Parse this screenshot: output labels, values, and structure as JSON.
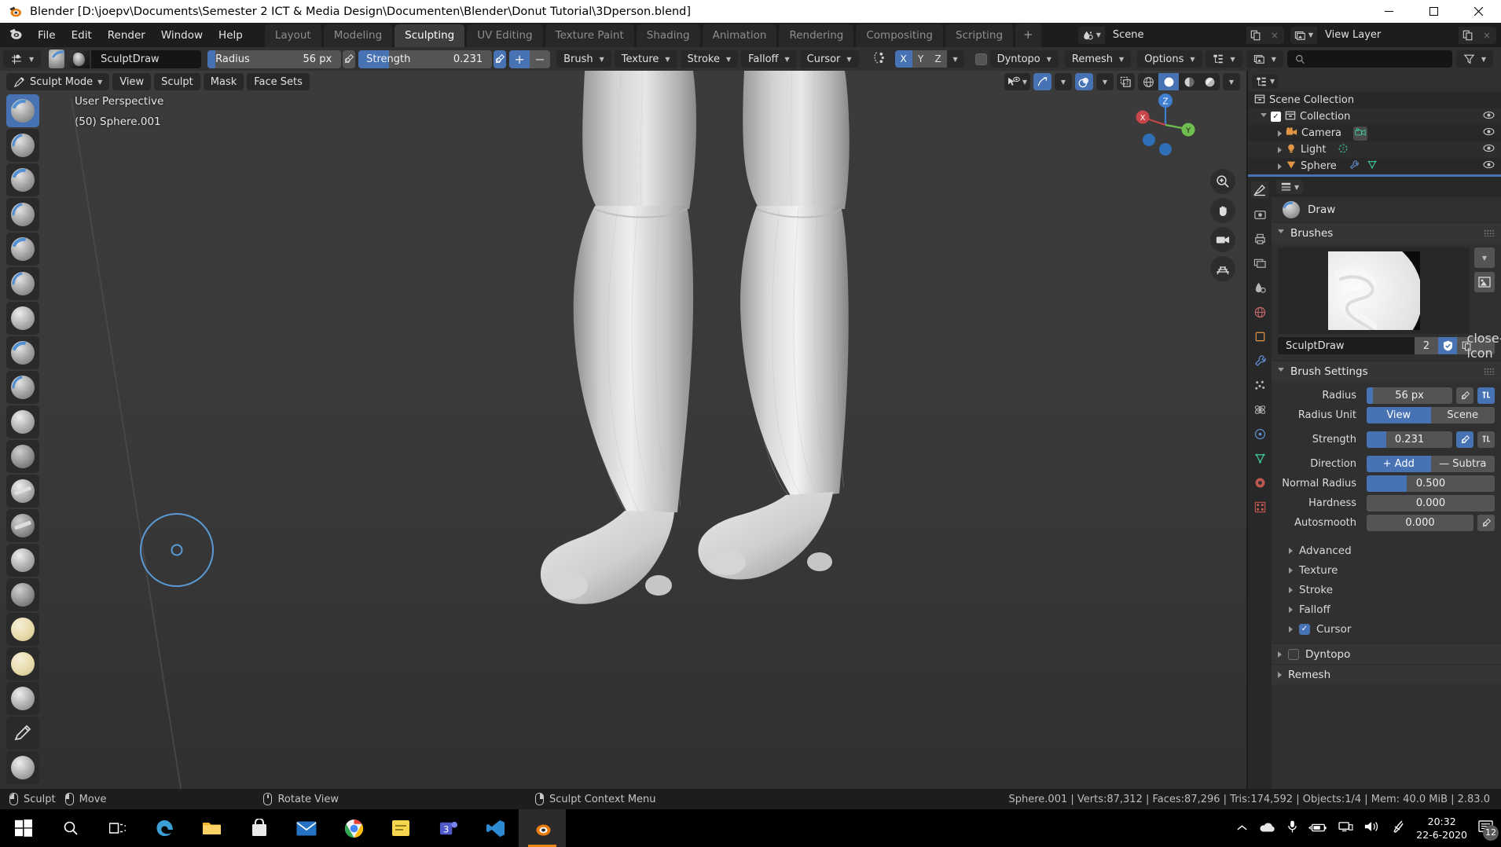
{
  "window": {
    "title": "Blender [D:\\joepv\\Documents\\Semester 2 ICT & Media Design\\Documenten\\Blender\\Donut Tutorial\\3Dperson.blend]",
    "minimize": "minimize-icon",
    "maximize": "maximize-icon",
    "close": "close-icon"
  },
  "topbar": {
    "logo": "blender-logo-icon",
    "menus": [
      "File",
      "Edit",
      "Render",
      "Window",
      "Help"
    ],
    "workspaces": [
      {
        "label": "Layout",
        "active": false
      },
      {
        "label": "Modeling",
        "active": false
      },
      {
        "label": "Sculpting",
        "active": true
      },
      {
        "label": "UV Editing",
        "active": false
      },
      {
        "label": "Texture Paint",
        "active": false
      },
      {
        "label": "Shading",
        "active": false
      },
      {
        "label": "Animation",
        "active": false
      },
      {
        "label": "Rendering",
        "active": false
      },
      {
        "label": "Compositing",
        "active": false
      },
      {
        "label": "Scripting",
        "active": false
      }
    ],
    "add_workspace": "+",
    "scene": {
      "name": "Scene",
      "new_label": "new-scene-icon",
      "unlink_label": "×"
    },
    "view_layer": {
      "name": "View Layer",
      "new_label": "new-viewlayer-icon",
      "unlink_label": "×"
    }
  },
  "tool_header": {
    "brush_name": "SculptDraw",
    "radius": {
      "label": "Radius",
      "value": "56 px",
      "fill_pct": 6
    },
    "radius_pressure": "pressure-icon",
    "strength": {
      "label": "Strength",
      "value": "0.231",
      "fill_pct": 23
    },
    "strength_pressure": "pressure-icon",
    "add": "+",
    "subtract": "−",
    "menus": [
      "Brush",
      "Texture",
      "Stroke",
      "Falloff",
      "Cursor"
    ],
    "symmetry": {
      "x": "X",
      "y": "Y",
      "z": "Z",
      "x_on": true,
      "y_on": false,
      "z_on": false
    },
    "dyntopo": "Dyntopo",
    "remesh": "Remesh",
    "options": "Options",
    "search_placeholder": ""
  },
  "viewport": {
    "mode": "Sculpt Mode",
    "menus": [
      "View",
      "Sculpt",
      "Mask",
      "Face Sets"
    ],
    "overlay_line1": "User Perspective",
    "overlay_line2": "(50) Sphere.001",
    "gizmo_axes": {
      "x": "X",
      "y": "Y",
      "z": "Z"
    },
    "shading_modes": [
      "wireframe",
      "solid",
      "material-preview",
      "rendered"
    ],
    "active_shading": "solid"
  },
  "outliner": {
    "display_mode_icon": "outliner-filter-icon",
    "search_placeholder": "",
    "rows": [
      {
        "label": "Scene Collection",
        "depth": 0,
        "icon": "collection-icon",
        "selected": false
      },
      {
        "label": "Collection",
        "depth": 1,
        "icon": "collection-icon",
        "selected": false,
        "checkbox": true
      },
      {
        "label": "Camera",
        "depth": 2,
        "icon": "camera-icon",
        "selected": false,
        "extra": "camera-data-icon"
      },
      {
        "label": "Light",
        "depth": 2,
        "icon": "light-icon",
        "selected": false,
        "extra": "light-data-icon"
      },
      {
        "label": "Sphere",
        "depth": 2,
        "icon": "mesh-icon",
        "selected": false,
        "extra": "modifier-icon"
      }
    ]
  },
  "properties": {
    "breadcrumb": "Draw",
    "brushes_panel": {
      "title": "Brushes",
      "brush_name": "SculptDraw",
      "users": "2",
      "fake_user_icon": "shield-icon",
      "duplicate_icon": "copy-icon",
      "delete_icon": "close-icon"
    },
    "brush_settings": {
      "title": "Brush Settings",
      "rows": [
        {
          "label": "Radius",
          "value": "56 px",
          "fill_pct": 7,
          "type": "slider",
          "pressure": true,
          "unified": true,
          "unified_on": true
        },
        {
          "label": "Radius Unit",
          "type": "segmented",
          "options": [
            "View",
            "Scene"
          ],
          "selected": "View"
        },
        {
          "label": "Strength",
          "value": "0.231",
          "fill_pct": 23,
          "type": "slider",
          "pressure": true,
          "pressure_on": true,
          "unified": true
        },
        {
          "label": "Direction",
          "type": "segmented",
          "options": [
            "+  Add",
            "—  Subtra"
          ],
          "selected": "+  Add"
        },
        {
          "label": "Normal Radius",
          "value": "0.500",
          "fill_pct": 50,
          "type": "slider"
        },
        {
          "label": "Hardness",
          "value": "0.000",
          "fill_pct": 0,
          "type": "slider"
        },
        {
          "label": "Autosmooth",
          "value": "0.000",
          "fill_pct": 0,
          "type": "slider",
          "pressure": true
        }
      ]
    },
    "subsections": [
      {
        "label": "Advanced",
        "checkbox": null
      },
      {
        "label": "Texture",
        "checkbox": null
      },
      {
        "label": "Stroke",
        "checkbox": null
      },
      {
        "label": "Falloff",
        "checkbox": null
      },
      {
        "label": "Cursor",
        "checkbox": true
      }
    ],
    "sections": [
      {
        "label": "Dyntopo",
        "checkbox": false
      },
      {
        "label": "Remesh",
        "checkbox": null
      }
    ],
    "tabs": [
      "tool-icon",
      "render-icon",
      "output-icon",
      "view-layer-icon",
      "scene-icon",
      "world-icon",
      "object-icon",
      "modifier-icon",
      "particles-icon",
      "physics-icon",
      "constraints-icon",
      "data-icon",
      "material-icon",
      "texture-icon"
    ]
  },
  "statusbar": {
    "keymaps": [
      {
        "mouse": "left",
        "label": "Sculpt"
      },
      {
        "mouse": "left-drag",
        "label": "Move"
      },
      {
        "mouse": "middle",
        "label": "Rotate View"
      },
      {
        "mouse": "right",
        "label": "Sculpt Context Menu"
      }
    ],
    "scene_stats": "Sphere.001 | Verts:87,312 | Faces:87,296 | Tris:174,592 | Objects:1/4 | Mem: 40.0 MiB | 2.83.0"
  },
  "taskbar": {
    "start": "windows-start-icon",
    "apps": [
      "search-icon",
      "task-view-icon",
      "edge-icon",
      "file-explorer-icon",
      "store-icon",
      "mail-icon",
      "chrome-icon",
      "sticky-notes-icon",
      "teams-icon",
      "vscode-icon",
      "blender-icon"
    ],
    "tray": [
      "show-hidden-icon",
      "onedrive-icon",
      "microphone-icon",
      "battery-icon",
      "network-icon",
      "volume-icon",
      "pen-icon"
    ],
    "time": "20:32",
    "date": "22-6-2020",
    "notification_count": "12"
  },
  "colors": {
    "accent": "#4772b3",
    "panel": "#303030",
    "dark": "#1d1d1d",
    "header": "#282828",
    "viewport_bg": "#393939"
  }
}
